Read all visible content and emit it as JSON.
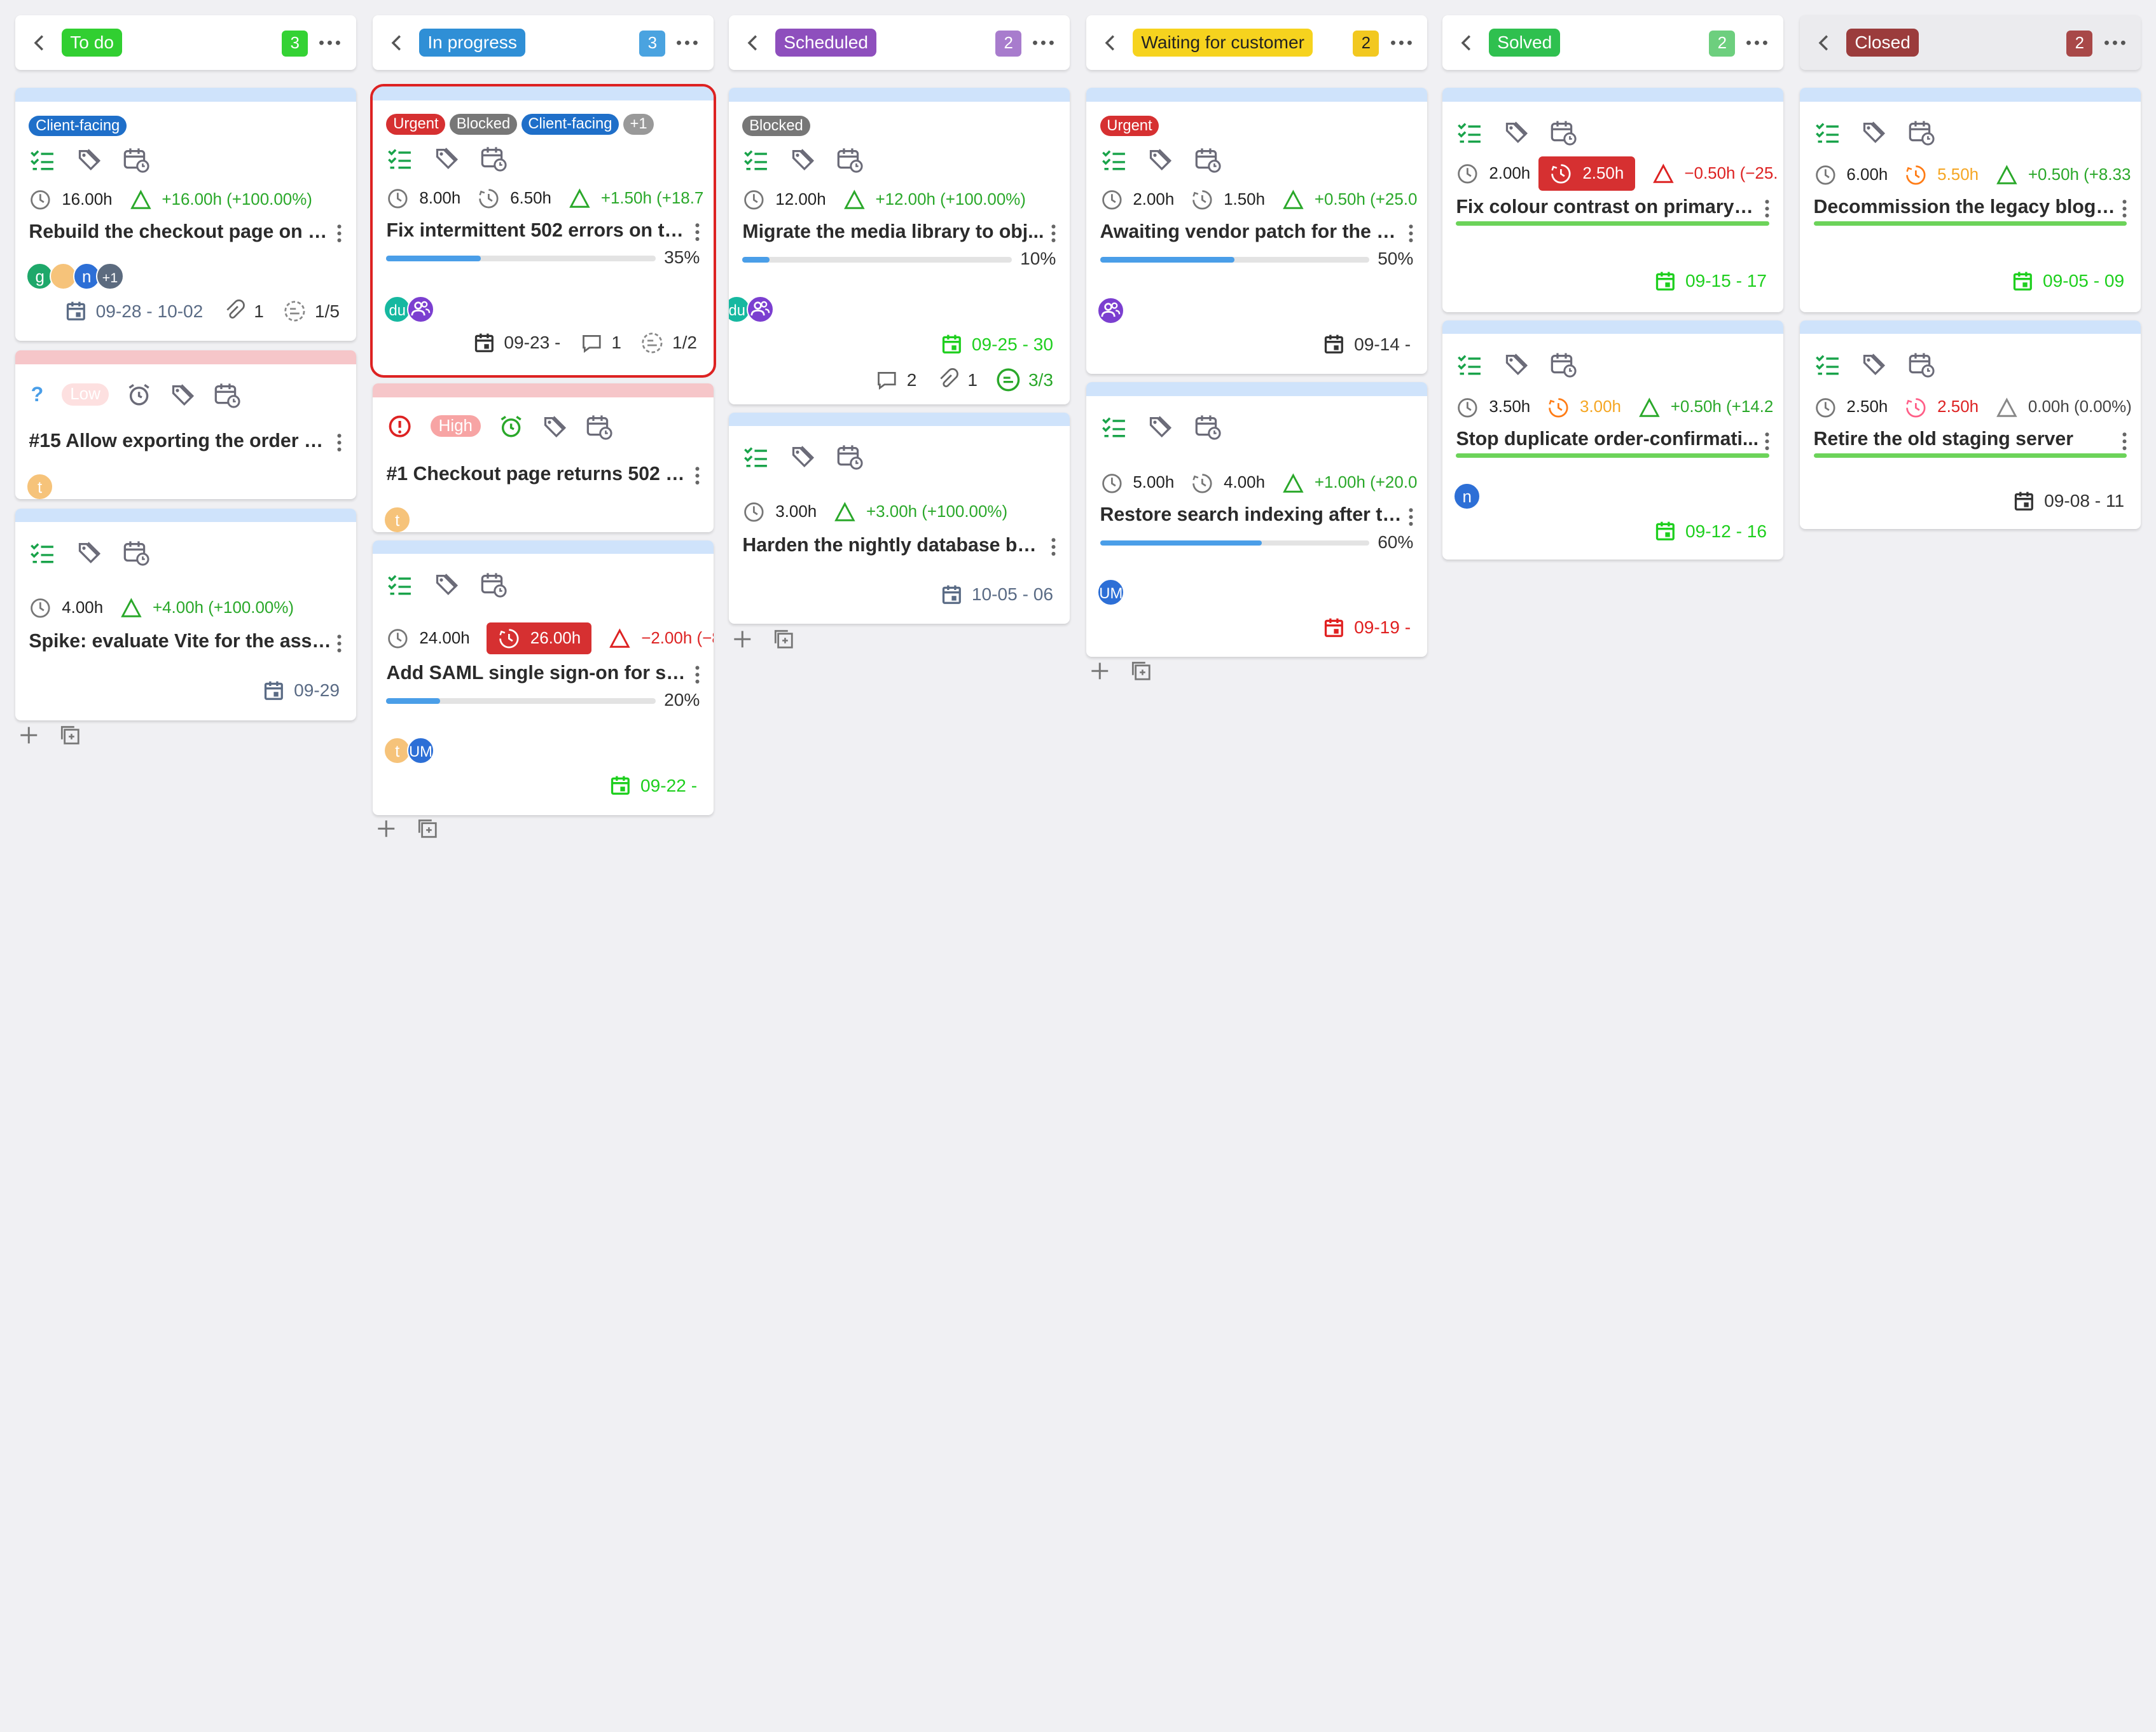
{
  "columns": [
    {
      "label": "To do",
      "count": "3",
      "color": "#31cf31",
      "countColor": "#34d234"
    },
    {
      "label": "In progress",
      "count": "3",
      "color": "#2f8fd6",
      "countColor": "#4aa3e0"
    },
    {
      "label": "Scheduled",
      "count": "2",
      "color": "#8e4fbd",
      "countColor": "#a87ccd"
    },
    {
      "label": "Waiting for customer",
      "count": "2",
      "color": "#f6d31e",
      "countColor": "#f2c820",
      "dark": true
    },
    {
      "label": "Solved",
      "count": "2",
      "color": "#2fc04f",
      "countColor": "#6dcf7e"
    },
    {
      "label": "Closed",
      "count": "2",
      "color": "#9b3c3c",
      "countColor": "#a84848"
    }
  ],
  "colors": {
    "green": "#2aa82a",
    "red": "#d22",
    "blue": "#4a9ee8",
    "orange": "#f5a623",
    "accentGreen": "#1ecf1e"
  },
  "c1": {
    "card1": {
      "tag": "Client-facing",
      "estimate": "16.00h",
      "delta": "+16.00h (+100.00%)",
      "title": "Rebuild the checkout page on th...",
      "avatars": [
        "g",
        "",
        "n",
        "+1"
      ],
      "dates": "09-28 - 10-02",
      "attachments": "1",
      "subtasks": "1/5"
    },
    "card2": {
      "priority_icon": "?",
      "priority": "Low",
      "title": "#15 Allow exporting the order hi...",
      "avatar": "t"
    },
    "card3": {
      "estimate": "4.00h",
      "delta": "+4.00h (+100.00%)",
      "title": "Spike: evaluate Vite for the asset...",
      "date": "09-29"
    }
  },
  "c2": {
    "card1": {
      "tags": [
        "Urgent",
        "Blocked",
        "Client-facing",
        "+1"
      ],
      "estimate": "8.00h",
      "spent": "6.50h",
      "delta": "+1.50h (+18.7",
      "title": "Fix intermittent 502 errors on th...",
      "progress_pct": "35%",
      "progress": 0.35,
      "avatars": [
        "du",
        ""
      ],
      "date": "09-23 -",
      "comments": "1",
      "subtasks": "1/2"
    },
    "card2": {
      "priority": "High",
      "title": "#1 Checkout page returns 502 d...",
      "avatar": "t"
    },
    "card3": {
      "estimate": "24.00h",
      "spent": "26.00h",
      "delta": "−2.00h (−8",
      "title": "Add SAML single sign-on for staf...",
      "progress_pct": "20%",
      "progress": 0.2,
      "avatars": [
        "t",
        "UM"
      ],
      "date": "09-22 -"
    }
  },
  "c3": {
    "card1": {
      "tag": "Blocked",
      "estimate": "12.00h",
      "delta": "+12.00h (+100.00%)",
      "title": "Migrate the media library to obj...",
      "progress_pct": "10%",
      "progress": 0.1,
      "avatars": [
        "du",
        ""
      ],
      "date": "09-25 - 30",
      "comments": "2",
      "attachments": "1",
      "subtasks": "3/3"
    },
    "card2": {
      "estimate": "3.00h",
      "delta": "+3.00h (+100.00%)",
      "title": "Harden the nightly database bac...",
      "date": "10-05 - 06"
    }
  },
  "c4": {
    "card1": {
      "tag": "Urgent",
      "estimate": "2.00h",
      "spent": "1.50h",
      "delta": "+0.50h (+25.0",
      "title": "Awaiting vendor patch for the p...",
      "progress_pct": "50%",
      "progress": 0.5,
      "avatar": "",
      "date": "09-14 -"
    },
    "card2": {
      "estimate": "5.00h",
      "spent": "4.00h",
      "delta": "+1.00h (+20.0",
      "title": "Restore search indexing after th...",
      "progress_pct": "60%",
      "progress": 0.6,
      "avatar": "UM",
      "date": "09-19 -"
    }
  },
  "c5": {
    "card1": {
      "estimate": "2.00h",
      "spent": "2.50h",
      "delta": "−0.50h (−25.",
      "title": "Fix colour contrast on primary b...",
      "date": "09-15 - 17"
    },
    "card2": {
      "estimate": "3.50h",
      "spent": "3.00h",
      "delta": "+0.50h (+14.2",
      "title": "Stop duplicate order-confirmati...",
      "avatar": "n",
      "date": "09-12 - 16"
    }
  },
  "c6": {
    "card1": {
      "estimate": "6.00h",
      "spent": "5.50h",
      "delta": "+0.50h (+8.33",
      "title": "Decommission the legacy blog a...",
      "date": "09-05 - 09"
    },
    "card2": {
      "estimate": "2.50h",
      "spent": "2.50h",
      "delta": "0.00h (0.00%)",
      "title": "Retire the old staging server",
      "date": "09-08 - 11"
    }
  }
}
